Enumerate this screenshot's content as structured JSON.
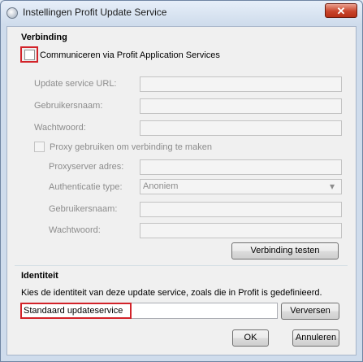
{
  "window": {
    "title": "Instellingen Profit Update Service",
    "close_glyph": "✕"
  },
  "verbinding": {
    "heading": "Verbinding",
    "communicate_checkbox_label": "Communiceren via Profit Application Services",
    "update_service_url_label": "Update service URL:",
    "gebruikersnaam_label": "Gebruikersnaam:",
    "wachtwoord_label": "Wachtwoord:",
    "proxy_checkbox_label": "Proxy gebruiken om verbinding te maken",
    "proxyserver_label": "Proxyserver adres:",
    "authenticatie_label": "Authenticatie type:",
    "authenticatie_value": "Anoniem",
    "proxy_gebruikersnaam_label": "Gebruikersnaam:",
    "proxy_wachtwoord_label": "Wachtwoord:",
    "test_button": "Verbinding testen"
  },
  "identiteit": {
    "heading": "Identiteit",
    "description": "Kies de identiteit van deze update service, zoals die in Profit is gedefinieerd.",
    "selected_value": "Standaard updateservice",
    "refresh_button": "Verversen"
  },
  "footer": {
    "ok_button": "OK",
    "cancel_button": "Annuleren"
  },
  "icons": {
    "dropdown": "▾"
  }
}
